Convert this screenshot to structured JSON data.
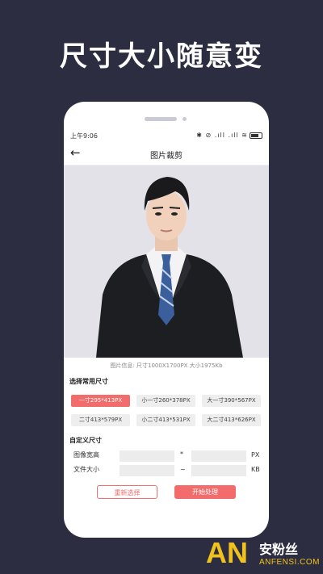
{
  "headline": "尺寸大小随意变",
  "status": {
    "time": "上午9:06",
    "icons": "✱ ⊘ .ıll .ıll ≋"
  },
  "nav": {
    "back_icon": "←",
    "title": "图片裁剪"
  },
  "photo": {
    "info": "图片信息: 尺寸1000X1700PX  大小1975Kb"
  },
  "common_sizes": {
    "title": "选择常用尺寸",
    "options": [
      {
        "label": "一寸295*413PX",
        "selected": true
      },
      {
        "label": "小一寸260*378PX",
        "selected": false
      },
      {
        "label": "大一寸390*567PX",
        "selected": false
      },
      {
        "label": "二寸413*579PX",
        "selected": false
      },
      {
        "label": "小二寸413*531PX",
        "selected": false
      },
      {
        "label": "大二寸413*626PX",
        "selected": false
      }
    ]
  },
  "custom": {
    "title": "自定义尺寸",
    "dimension_label": "图像宽高",
    "dimension_sep": "*",
    "dimension_unit": "PX",
    "filesize_label": "文件大小",
    "filesize_sep": "~",
    "filesize_unit": "KB",
    "width_value": "",
    "height_value": "",
    "size_min_value": "",
    "size_max_value": ""
  },
  "actions": {
    "reselect": "重新选择",
    "start": "开始处理"
  },
  "watermark": {
    "mark": "AN",
    "cn": "安粉丝",
    "en": "ANFENSI.COM"
  },
  "colors": {
    "accent": "#f36c6c",
    "background": "#2c2d40",
    "logo": "#f1c21b"
  }
}
